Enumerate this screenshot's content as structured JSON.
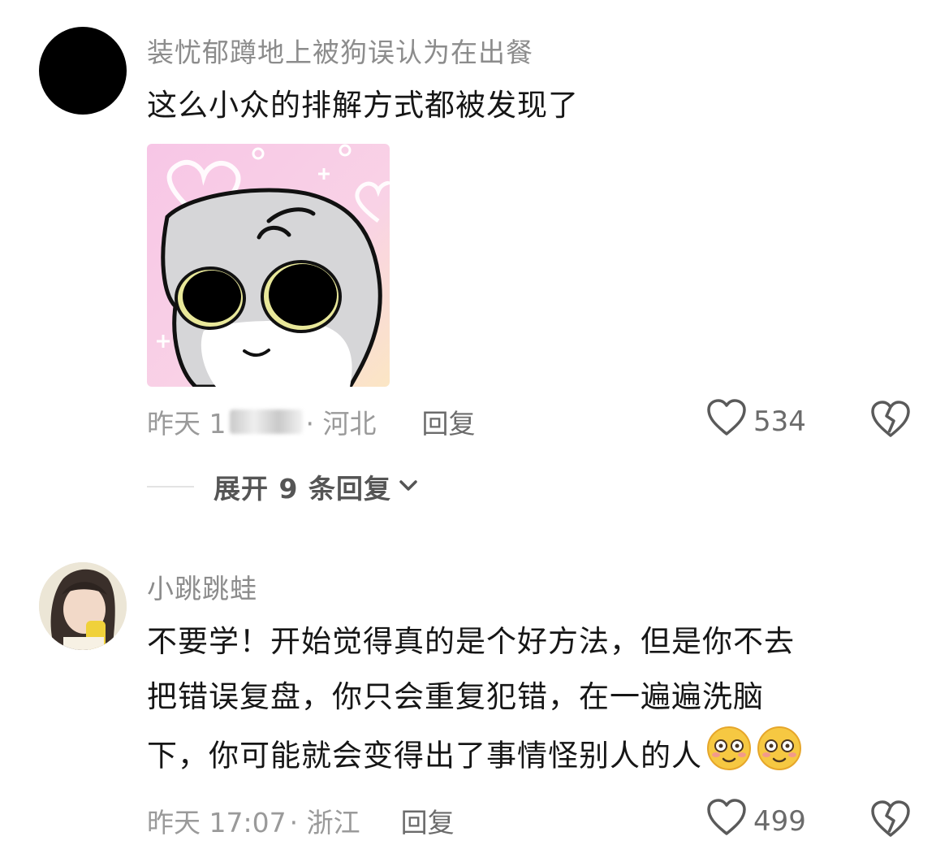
{
  "comments": [
    {
      "username": "装忧郁蹲地上被狗误认为在出餐",
      "text": "这么小众的排解方式都被发现了",
      "meta_time": "昨天 1",
      "meta_location": "· 河北",
      "reply_label": "回复",
      "likes": "534",
      "has_sticker": true
    },
    {
      "username": "小跳跳蛙",
      "text_lines": [
        "不要学！开始觉得真的是个好方法，但是你不去",
        "把错误复盘，你只会重复犯错，在一遍遍洗脑",
        "下，你可能就会变得出了事情怪别人的人"
      ],
      "meta_time": "昨天 17:07",
      "meta_location": "· 浙江",
      "reply_label": "回复",
      "likes": "499"
    }
  ],
  "expand_replies_label": "展开 9 条回复",
  "icons": {
    "like": "heart-outline-icon",
    "dislike": "broken-heart-icon",
    "expand": "chevron-down-icon",
    "emoji": "blushing-face-emoji"
  }
}
